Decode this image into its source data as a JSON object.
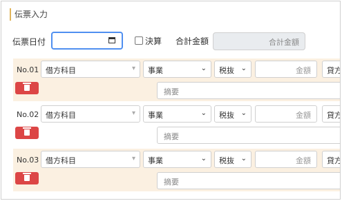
{
  "header": {
    "title": "伝票入力"
  },
  "form": {
    "date_label": "伝票日付",
    "settle_label": "決算",
    "total_label": "合計金額",
    "total_placeholder": "合計金額"
  },
  "entries": [
    {
      "no": "No.01",
      "account": "借方科目",
      "business": "事業",
      "tax": "税抜",
      "amount_placeholder": "金額",
      "credit": "貸方",
      "memo_placeholder": "摘要"
    },
    {
      "no": "No.02",
      "account": "借方科目",
      "business": "事業",
      "tax": "税抜",
      "amount_placeholder": "金額",
      "credit": "貸方",
      "memo_placeholder": "摘要"
    },
    {
      "no": "No.03",
      "account": "借方科目",
      "business": "事業",
      "tax": "税抜",
      "amount_placeholder": "金額",
      "credit": "貸方",
      "memo_placeholder": "摘要"
    }
  ],
  "icons": {
    "calendar": "calendar-icon",
    "trash": "trash-icon",
    "dropdown": "chevron-down-icon"
  },
  "colors": {
    "accent": "#e0b45a",
    "focus": "#4f8ff0",
    "row_bg": "#fbf0e1",
    "delete": "#dc4646"
  }
}
